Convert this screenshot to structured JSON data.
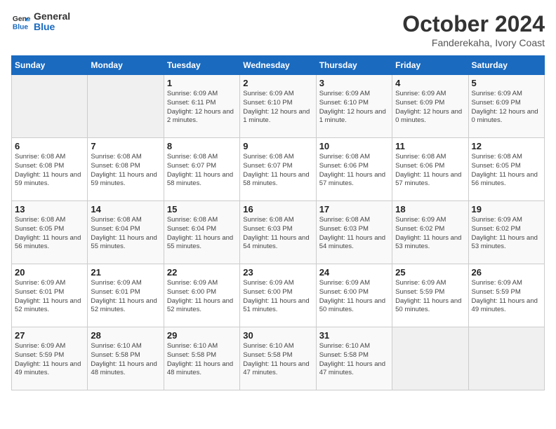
{
  "header": {
    "logo_line1": "General",
    "logo_line2": "Blue",
    "month": "October 2024",
    "location": "Fanderekaha, Ivory Coast"
  },
  "weekdays": [
    "Sunday",
    "Monday",
    "Tuesday",
    "Wednesday",
    "Thursday",
    "Friday",
    "Saturday"
  ],
  "weeks": [
    [
      {
        "day": "",
        "sunrise": "",
        "sunset": "",
        "daylight": "",
        "empty": true
      },
      {
        "day": "",
        "sunrise": "",
        "sunset": "",
        "daylight": "",
        "empty": true
      },
      {
        "day": "1",
        "sunrise": "Sunrise: 6:09 AM",
        "sunset": "Sunset: 6:11 PM",
        "daylight": "Daylight: 12 hours and 2 minutes."
      },
      {
        "day": "2",
        "sunrise": "Sunrise: 6:09 AM",
        "sunset": "Sunset: 6:10 PM",
        "daylight": "Daylight: 12 hours and 1 minute."
      },
      {
        "day": "3",
        "sunrise": "Sunrise: 6:09 AM",
        "sunset": "Sunset: 6:10 PM",
        "daylight": "Daylight: 12 hours and 1 minute."
      },
      {
        "day": "4",
        "sunrise": "Sunrise: 6:09 AM",
        "sunset": "Sunset: 6:09 PM",
        "daylight": "Daylight: 12 hours and 0 minutes."
      },
      {
        "day": "5",
        "sunrise": "Sunrise: 6:09 AM",
        "sunset": "Sunset: 6:09 PM",
        "daylight": "Daylight: 12 hours and 0 minutes."
      }
    ],
    [
      {
        "day": "6",
        "sunrise": "Sunrise: 6:08 AM",
        "sunset": "Sunset: 6:08 PM",
        "daylight": "Daylight: 11 hours and 59 minutes."
      },
      {
        "day": "7",
        "sunrise": "Sunrise: 6:08 AM",
        "sunset": "Sunset: 6:08 PM",
        "daylight": "Daylight: 11 hours and 59 minutes."
      },
      {
        "day": "8",
        "sunrise": "Sunrise: 6:08 AM",
        "sunset": "Sunset: 6:07 PM",
        "daylight": "Daylight: 11 hours and 58 minutes."
      },
      {
        "day": "9",
        "sunrise": "Sunrise: 6:08 AM",
        "sunset": "Sunset: 6:07 PM",
        "daylight": "Daylight: 11 hours and 58 minutes."
      },
      {
        "day": "10",
        "sunrise": "Sunrise: 6:08 AM",
        "sunset": "Sunset: 6:06 PM",
        "daylight": "Daylight: 11 hours and 57 minutes."
      },
      {
        "day": "11",
        "sunrise": "Sunrise: 6:08 AM",
        "sunset": "Sunset: 6:06 PM",
        "daylight": "Daylight: 11 hours and 57 minutes."
      },
      {
        "day": "12",
        "sunrise": "Sunrise: 6:08 AM",
        "sunset": "Sunset: 6:05 PM",
        "daylight": "Daylight: 11 hours and 56 minutes."
      }
    ],
    [
      {
        "day": "13",
        "sunrise": "Sunrise: 6:08 AM",
        "sunset": "Sunset: 6:05 PM",
        "daylight": "Daylight: 11 hours and 56 minutes."
      },
      {
        "day": "14",
        "sunrise": "Sunrise: 6:08 AM",
        "sunset": "Sunset: 6:04 PM",
        "daylight": "Daylight: 11 hours and 55 minutes."
      },
      {
        "day": "15",
        "sunrise": "Sunrise: 6:08 AM",
        "sunset": "Sunset: 6:04 PM",
        "daylight": "Daylight: 11 hours and 55 minutes."
      },
      {
        "day": "16",
        "sunrise": "Sunrise: 6:08 AM",
        "sunset": "Sunset: 6:03 PM",
        "daylight": "Daylight: 11 hours and 54 minutes."
      },
      {
        "day": "17",
        "sunrise": "Sunrise: 6:08 AM",
        "sunset": "Sunset: 6:03 PM",
        "daylight": "Daylight: 11 hours and 54 minutes."
      },
      {
        "day": "18",
        "sunrise": "Sunrise: 6:09 AM",
        "sunset": "Sunset: 6:02 PM",
        "daylight": "Daylight: 11 hours and 53 minutes."
      },
      {
        "day": "19",
        "sunrise": "Sunrise: 6:09 AM",
        "sunset": "Sunset: 6:02 PM",
        "daylight": "Daylight: 11 hours and 53 minutes."
      }
    ],
    [
      {
        "day": "20",
        "sunrise": "Sunrise: 6:09 AM",
        "sunset": "Sunset: 6:01 PM",
        "daylight": "Daylight: 11 hours and 52 minutes."
      },
      {
        "day": "21",
        "sunrise": "Sunrise: 6:09 AM",
        "sunset": "Sunset: 6:01 PM",
        "daylight": "Daylight: 11 hours and 52 minutes."
      },
      {
        "day": "22",
        "sunrise": "Sunrise: 6:09 AM",
        "sunset": "Sunset: 6:00 PM",
        "daylight": "Daylight: 11 hours and 52 minutes."
      },
      {
        "day": "23",
        "sunrise": "Sunrise: 6:09 AM",
        "sunset": "Sunset: 6:00 PM",
        "daylight": "Daylight: 11 hours and 51 minutes."
      },
      {
        "day": "24",
        "sunrise": "Sunrise: 6:09 AM",
        "sunset": "Sunset: 6:00 PM",
        "daylight": "Daylight: 11 hours and 50 minutes."
      },
      {
        "day": "25",
        "sunrise": "Sunrise: 6:09 AM",
        "sunset": "Sunset: 5:59 PM",
        "daylight": "Daylight: 11 hours and 50 minutes."
      },
      {
        "day": "26",
        "sunrise": "Sunrise: 6:09 AM",
        "sunset": "Sunset: 5:59 PM",
        "daylight": "Daylight: 11 hours and 49 minutes."
      }
    ],
    [
      {
        "day": "27",
        "sunrise": "Sunrise: 6:09 AM",
        "sunset": "Sunset: 5:59 PM",
        "daylight": "Daylight: 11 hours and 49 minutes."
      },
      {
        "day": "28",
        "sunrise": "Sunrise: 6:10 AM",
        "sunset": "Sunset: 5:58 PM",
        "daylight": "Daylight: 11 hours and 48 minutes."
      },
      {
        "day": "29",
        "sunrise": "Sunrise: 6:10 AM",
        "sunset": "Sunset: 5:58 PM",
        "daylight": "Daylight: 11 hours and 48 minutes."
      },
      {
        "day": "30",
        "sunrise": "Sunrise: 6:10 AM",
        "sunset": "Sunset: 5:58 PM",
        "daylight": "Daylight: 11 hours and 47 minutes."
      },
      {
        "day": "31",
        "sunrise": "Sunrise: 6:10 AM",
        "sunset": "Sunset: 5:58 PM",
        "daylight": "Daylight: 11 hours and 47 minutes."
      },
      {
        "day": "",
        "sunrise": "",
        "sunset": "",
        "daylight": "",
        "empty": true
      },
      {
        "day": "",
        "sunrise": "",
        "sunset": "",
        "daylight": "",
        "empty": true
      }
    ]
  ]
}
